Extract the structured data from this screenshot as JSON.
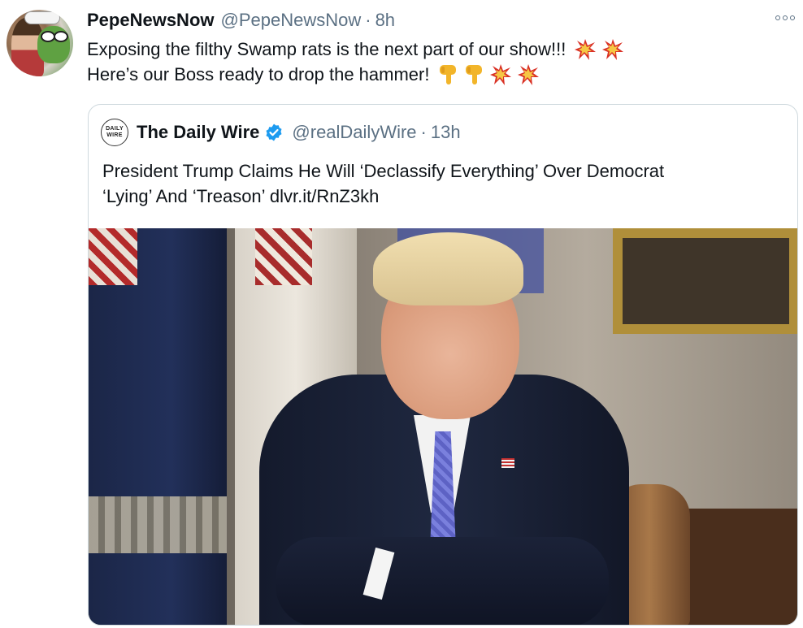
{
  "tweet": {
    "author_name": "PepeNewsNow",
    "author_handle": "@PepeNewsNow",
    "separator": "·",
    "time": "8h",
    "avatar_icon": "user-avatar-icon",
    "more_icon": "more-options-icon",
    "lines": [
      "Exposing the filthy Swamp rats is the next part of our show!!!",
      "Here’s our Boss ready to drop the hammer!"
    ],
    "line1_emojis": [
      "💥",
      "💥"
    ],
    "line2_emojis": [
      "👇",
      "👇",
      "💥",
      "💥"
    ]
  },
  "quote": {
    "author_name": "The Daily Wire",
    "author_handle": "@realDailyWire",
    "separator": "·",
    "time": "13h",
    "avatar_text": [
      "DAILY",
      "WIRE"
    ],
    "verified_icon": "verified-badge-icon",
    "text_lines": [
      "President Trump Claims He Will ‘Declassify Everything’ Over Democrat",
      "‘Lying’ And ‘Treason’ dlvr.it/RnZ3kh"
    ]
  },
  "colors": {
    "text_primary": "#0f1419",
    "text_secondary": "#5b7083",
    "border": "#cfd9de",
    "verified": "#1d9bf0"
  }
}
